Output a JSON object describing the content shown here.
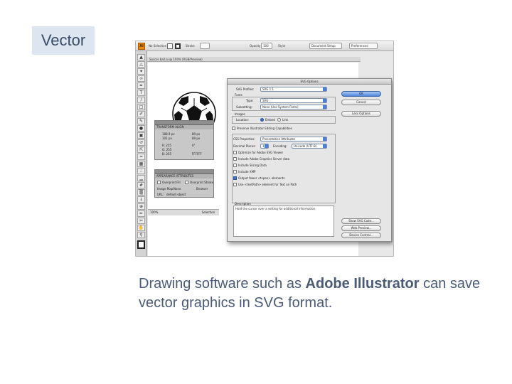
{
  "slide": {
    "title": "Vector",
    "caption_before": "Drawing software such as ",
    "caption_bold": "Adobe Illustrator",
    "caption_after": " can save vector graphics in SVG format.",
    "caption_color": "#4a5a78"
  },
  "illustrator": {
    "app_icon": "Ai",
    "control_bar": {
      "selection_label": "No Selection",
      "stroke_label": "Stroke",
      "opacity_label": "Opacity",
      "opacity_value": "100",
      "style_label": "Style",
      "document_setup": "Document Setup",
      "preferences": "Preferences"
    },
    "tab_title": "Soccer ball.ai @ 100% (RGB/Preview)",
    "status_zoom": "100%",
    "status_text": "Selection",
    "panels": {
      "transform_tabs": "TRANSFORM  ALIGN",
      "x_value": "188.9 px",
      "y_value": "101 px",
      "w_value": "89 px",
      "h_value": "89 px",
      "angle": "0°",
      "color_r": "R: 255",
      "color_g": "G: 255",
      "color_b": "B: 255",
      "hex": "FFFFFF",
      "symbols_tabs": "APPEARANCE  ATTRIBUTES",
      "overprint_fill": "Overprint Fill",
      "overprint_stroke": "Overprint Stroke",
      "image_map": "Image Map:",
      "image_map_value": "None",
      "browser": "Browser",
      "url_label": "URL:",
      "url_value": "default object"
    }
  },
  "svg_dialog": {
    "title": "SVG Options",
    "profiles_label": "SVG Profiles:",
    "profiles_value": "SVG 1.1",
    "fonts_label": "Fonts",
    "type_label": "Type:",
    "type_value": "SVG",
    "subsetting_label": "Subsetting:",
    "subsetting_value": "None (Use System Fonts)",
    "images_label": "Images",
    "location_label": "Location:",
    "embed_label": "Embed",
    "link_label": "Link",
    "preserve_label": "Preserve Illustrator Editing Capabilities",
    "css_label": "CSS Properties:",
    "css_value": "Presentation Attributes",
    "decimal_label": "Decimal Places:",
    "decimal_value": "1",
    "encoding_label": "Encoding:",
    "encoding_value": "Unicode (UTF-8)",
    "opt_optimize": "Optimize for Adobe SVG Viewer",
    "opt_graphics_server": "Include Adobe Graphics Server data",
    "opt_slicing": "Include Slicing Data",
    "opt_xmp": "Include XMP",
    "opt_fewer_tspan": "Output fewer <tspan> elements",
    "opt_textpath": "Use <textPath> element for Text on Path",
    "description_label": "Description",
    "description_text": "Hold the cursor over a setting for additional information.",
    "ok": "OK",
    "cancel": "Cancel",
    "less_options": "Less Options",
    "show_svg_code": "Show SVG Code...",
    "web_preview": "Web Preview...",
    "device_central": "Device Central..."
  }
}
